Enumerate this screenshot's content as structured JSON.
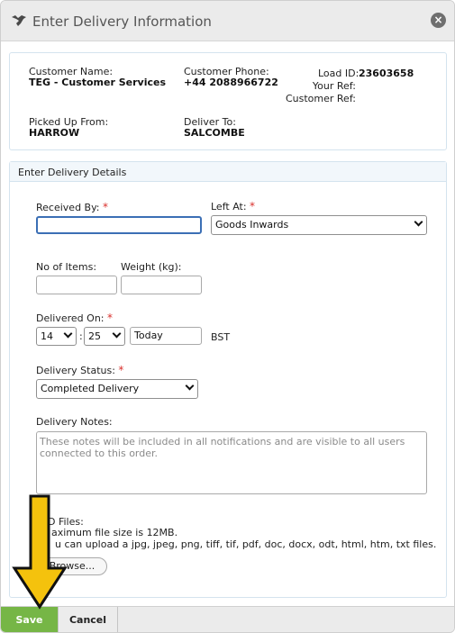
{
  "dialog": {
    "title": "Enter Delivery Information",
    "close_icon": "close-icon",
    "title_icon": "handshake-icon"
  },
  "summary": {
    "customer_name_label": "Customer Name:",
    "customer_name": "TEG - Customer Services",
    "customer_phone_label": "Customer Phone:",
    "customer_phone": "+44 2088966722",
    "load_id_label": "Load ID:",
    "load_id": "23603658",
    "your_ref_label": "Your Ref:",
    "customer_ref_label": "Customer Ref:",
    "picked_up_label": "Picked Up From:",
    "picked_up": "HARROW",
    "deliver_to_label": "Deliver To:",
    "deliver_to": "SALCOMBE"
  },
  "details": {
    "header": "Enter Delivery Details",
    "received_by_label": "Received By:",
    "received_by_value": "",
    "left_at_label": "Left At:",
    "left_at_value": "Goods Inwards",
    "no_items_label": "No of Items:",
    "no_items_value": "",
    "weight_label": "Weight (kg):",
    "weight_value": "",
    "delivered_on_label": "Delivered On:",
    "hour": "14",
    "time_sep": ":",
    "minute": "25",
    "date": "Today",
    "timezone": "BST",
    "status_label": "Delivery Status:",
    "status_value": "Completed Delivery",
    "notes_label": "Delivery Notes:",
    "notes_placeholder": "These notes will be included in all notifications and are visible to all users connected to this order.",
    "required_mark": "*",
    "pod_label": "D Files:",
    "pod_max": "aximum file size is 12MB.",
    "pod_types": "u can upload a jpg, jpeg, png, tiff, tif, pdf, doc, docx, odt, html, htm, txt files.",
    "browse_label": "Browse..."
  },
  "footer": {
    "save_label": "Save",
    "cancel_label": "Cancel"
  },
  "colors": {
    "save": "#76b646",
    "required": "#d9302c",
    "arrow": "#f4c20d"
  }
}
